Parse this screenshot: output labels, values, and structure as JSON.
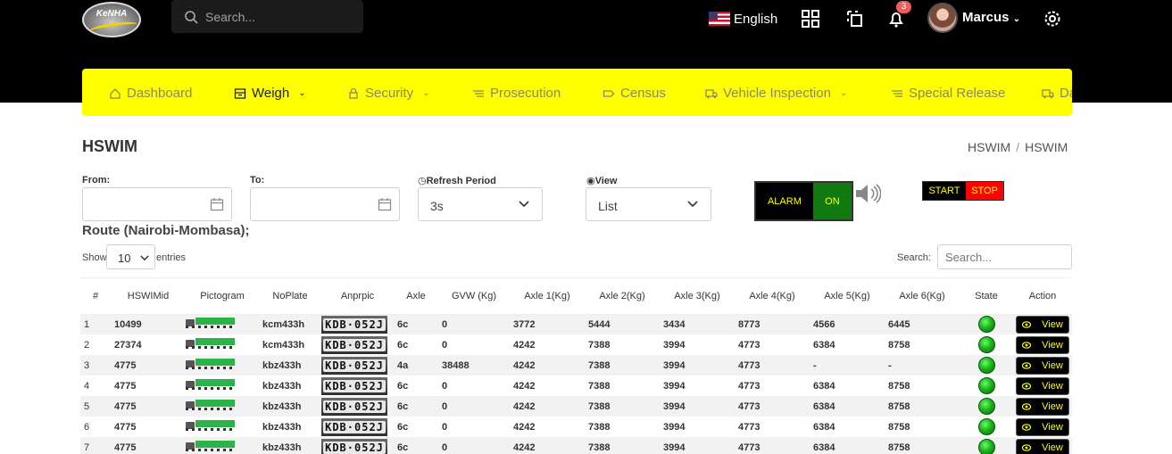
{
  "header": {
    "logo_text": "KeNHA",
    "search_placeholder": "Search...",
    "language": "English",
    "notification_count": "3",
    "user_name": "Marcus"
  },
  "nav": {
    "items": [
      {
        "label": "Dashboard",
        "icon": "home-icon"
      },
      {
        "label": "Weigh",
        "icon": "scale-icon",
        "dropdown": true
      },
      {
        "label": "Security",
        "icon": "lock-icon",
        "dropdown": true
      },
      {
        "label": "Prosecution",
        "icon": "list-icon"
      },
      {
        "label": "Census",
        "icon": "tag-icon"
      },
      {
        "label": "Vehicle Inspection",
        "icon": "truck-icon",
        "dropdown": true
      },
      {
        "label": "Special Release",
        "icon": "list-icon"
      },
      {
        "label": "Data",
        "icon": "truck-icon",
        "dropdown": true
      }
    ]
  },
  "page": {
    "title": "HSWIM",
    "breadcrumb": [
      "HSWIM",
      "HSWIM"
    ]
  },
  "filters": {
    "from_label": "From:",
    "to_label": "To:",
    "refresh_label": "Refresh Period",
    "refresh_value": "3s",
    "view_label": "View",
    "view_value": "List"
  },
  "controls": {
    "alarm": "ALARM",
    "on": "ON",
    "start": "START",
    "stop": "STOP"
  },
  "route": "Route (Nairobi-Mombasa);",
  "table_controls": {
    "show": "Show",
    "entries_value": "10",
    "entries": "entries",
    "search_label": "Search:",
    "search_placeholder": "Search..."
  },
  "table": {
    "headers": [
      "#",
      "HSWIMid",
      "Pictogram",
      "NoPlate",
      "Anprpic",
      "Axle",
      "GVW (Kg)",
      "Axle 1(Kg)",
      "Axle 2(Kg)",
      "Axle 3(Kg)",
      "Axle 4(Kg)",
      "Axle 5(Kg)",
      "Axle 6(Kg)",
      "State",
      "Action"
    ],
    "plate_image_text": "KDB·052J",
    "view_label": "View",
    "state_color": "#1db31d",
    "rows": [
      {
        "n": "1",
        "id": "10499",
        "plate": "kcm433h",
        "axle": "6c",
        "gvw": "0",
        "a1": "3772",
        "a2": "5444",
        "a3": "3434",
        "a4": "8773",
        "a5": "4566",
        "a6": "6445"
      },
      {
        "n": "2",
        "id": "27374",
        "plate": "kcm433h",
        "axle": "6c",
        "gvw": "0",
        "a1": "4242",
        "a2": "7388",
        "a3": "3994",
        "a4": "4773",
        "a5": "6384",
        "a6": "8758"
      },
      {
        "n": "3",
        "id": "4775",
        "plate": "kbz433h",
        "axle": "4a",
        "gvw": "38488",
        "a1": "4242",
        "a2": "7388",
        "a3": "3994",
        "a4": "4773",
        "a5": "-",
        "a6": "-"
      },
      {
        "n": "4",
        "id": "4775",
        "plate": "kbz433h",
        "axle": "6c",
        "gvw": "0",
        "a1": "4242",
        "a2": "7388",
        "a3": "3994",
        "a4": "4773",
        "a5": "6384",
        "a6": "8758"
      },
      {
        "n": "5",
        "id": "4775",
        "plate": "kbz433h",
        "axle": "6c",
        "gvw": "0",
        "a1": "4242",
        "a2": "7388",
        "a3": "3994",
        "a4": "4773",
        "a5": "6384",
        "a6": "8758"
      },
      {
        "n": "6",
        "id": "4775",
        "plate": "kbz433h",
        "axle": "6c",
        "gvw": "0",
        "a1": "4242",
        "a2": "7388",
        "a3": "3994",
        "a4": "4773",
        "a5": "6384",
        "a6": "8758"
      },
      {
        "n": "7",
        "id": "4775",
        "plate": "kbz433h",
        "axle": "6c",
        "gvw": "0",
        "a1": "4242",
        "a2": "7388",
        "a3": "3994",
        "a4": "4773",
        "a5": "6384",
        "a6": "8758"
      }
    ]
  }
}
